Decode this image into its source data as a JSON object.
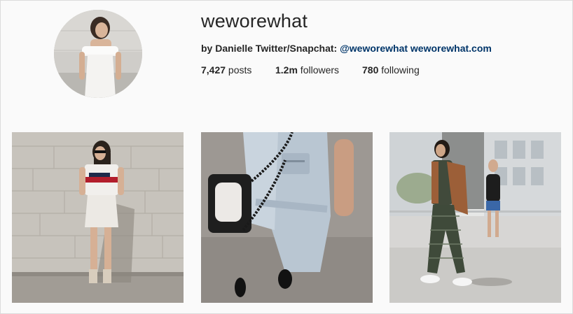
{
  "profile": {
    "username": "weworewhat",
    "bio": {
      "prefix": "by Danielle Twitter/Snapchat: ",
      "handle": "@weworewhat",
      "separator": " ",
      "website": "weworewhat.com"
    },
    "stats": {
      "posts_count": "7,427",
      "posts_label": " posts",
      "followers_count": "1.2m",
      "followers_label": " followers",
      "following_count": "780",
      "following_label": " following"
    },
    "avatar": {
      "description_icon": "profile-photo-icon"
    }
  },
  "posts": [
    {
      "icon": "photo-tile-icon"
    },
    {
      "icon": "photo-tile-icon"
    },
    {
      "icon": "photo-tile-icon"
    }
  ],
  "colors": {
    "link": "#003569",
    "text": "#262626",
    "background": "#fafafa"
  }
}
